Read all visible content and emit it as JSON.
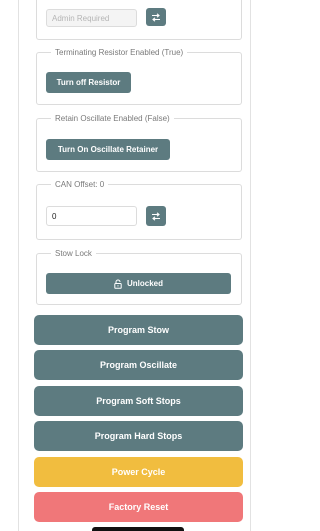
{
  "admin": {
    "placeholder": "Admin Required"
  },
  "terminating": {
    "legend": "Terminating Resistor Enabled (True)",
    "button": "Turn off Resistor"
  },
  "oscillate": {
    "legend": "Retain Oscillate Enabled (False)",
    "button": "Turn On Oscillate Retainer"
  },
  "can": {
    "legend": "CAN Offset: 0",
    "value": "0"
  },
  "stow": {
    "legend": "Stow Lock",
    "button": "Unlocked"
  },
  "actions": [
    {
      "label": "Program Stow",
      "color": "#5d7b80"
    },
    {
      "label": "Program Oscillate",
      "color": "#5d7b80"
    },
    {
      "label": "Program Soft Stops",
      "color": "#5d7b80"
    },
    {
      "label": "Program Hard Stops",
      "color": "#5d7b80"
    },
    {
      "label": "Power Cycle",
      "color": "#f1bd3f"
    },
    {
      "label": "Factory Reset",
      "color": "#f07779"
    }
  ],
  "icons": {
    "swap": "swap-arrows-icon",
    "lock": "unlock-icon"
  }
}
